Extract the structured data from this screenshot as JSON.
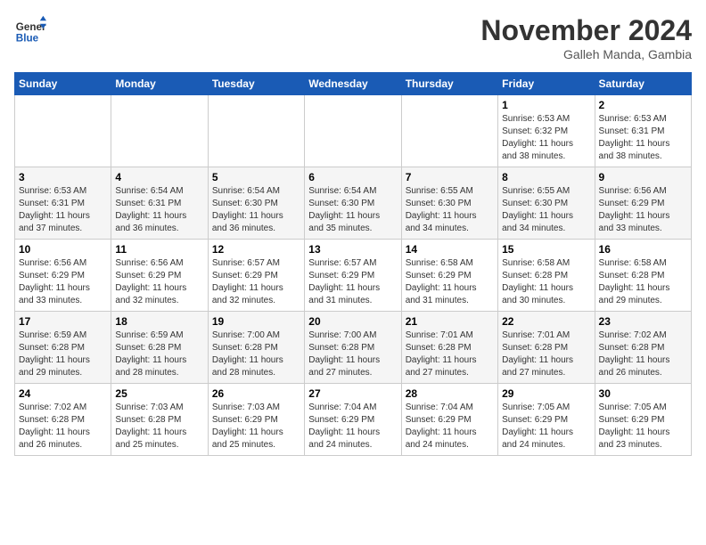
{
  "header": {
    "logo_line1": "General",
    "logo_line2": "Blue",
    "month_title": "November 2024",
    "subtitle": "Galleh Manda, Gambia"
  },
  "days_of_week": [
    "Sunday",
    "Monday",
    "Tuesday",
    "Wednesday",
    "Thursday",
    "Friday",
    "Saturday"
  ],
  "weeks": [
    [
      {
        "day": "",
        "detail": ""
      },
      {
        "day": "",
        "detail": ""
      },
      {
        "day": "",
        "detail": ""
      },
      {
        "day": "",
        "detail": ""
      },
      {
        "day": "",
        "detail": ""
      },
      {
        "day": "1",
        "detail": "Sunrise: 6:53 AM\nSunset: 6:32 PM\nDaylight: 11 hours\nand 38 minutes."
      },
      {
        "day": "2",
        "detail": "Sunrise: 6:53 AM\nSunset: 6:31 PM\nDaylight: 11 hours\nand 38 minutes."
      }
    ],
    [
      {
        "day": "3",
        "detail": "Sunrise: 6:53 AM\nSunset: 6:31 PM\nDaylight: 11 hours\nand 37 minutes."
      },
      {
        "day": "4",
        "detail": "Sunrise: 6:54 AM\nSunset: 6:31 PM\nDaylight: 11 hours\nand 36 minutes."
      },
      {
        "day": "5",
        "detail": "Sunrise: 6:54 AM\nSunset: 6:30 PM\nDaylight: 11 hours\nand 36 minutes."
      },
      {
        "day": "6",
        "detail": "Sunrise: 6:54 AM\nSunset: 6:30 PM\nDaylight: 11 hours\nand 35 minutes."
      },
      {
        "day": "7",
        "detail": "Sunrise: 6:55 AM\nSunset: 6:30 PM\nDaylight: 11 hours\nand 34 minutes."
      },
      {
        "day": "8",
        "detail": "Sunrise: 6:55 AM\nSunset: 6:30 PM\nDaylight: 11 hours\nand 34 minutes."
      },
      {
        "day": "9",
        "detail": "Sunrise: 6:56 AM\nSunset: 6:29 PM\nDaylight: 11 hours\nand 33 minutes."
      }
    ],
    [
      {
        "day": "10",
        "detail": "Sunrise: 6:56 AM\nSunset: 6:29 PM\nDaylight: 11 hours\nand 33 minutes."
      },
      {
        "day": "11",
        "detail": "Sunrise: 6:56 AM\nSunset: 6:29 PM\nDaylight: 11 hours\nand 32 minutes."
      },
      {
        "day": "12",
        "detail": "Sunrise: 6:57 AM\nSunset: 6:29 PM\nDaylight: 11 hours\nand 32 minutes."
      },
      {
        "day": "13",
        "detail": "Sunrise: 6:57 AM\nSunset: 6:29 PM\nDaylight: 11 hours\nand 31 minutes."
      },
      {
        "day": "14",
        "detail": "Sunrise: 6:58 AM\nSunset: 6:29 PM\nDaylight: 11 hours\nand 31 minutes."
      },
      {
        "day": "15",
        "detail": "Sunrise: 6:58 AM\nSunset: 6:28 PM\nDaylight: 11 hours\nand 30 minutes."
      },
      {
        "day": "16",
        "detail": "Sunrise: 6:58 AM\nSunset: 6:28 PM\nDaylight: 11 hours\nand 29 minutes."
      }
    ],
    [
      {
        "day": "17",
        "detail": "Sunrise: 6:59 AM\nSunset: 6:28 PM\nDaylight: 11 hours\nand 29 minutes."
      },
      {
        "day": "18",
        "detail": "Sunrise: 6:59 AM\nSunset: 6:28 PM\nDaylight: 11 hours\nand 28 minutes."
      },
      {
        "day": "19",
        "detail": "Sunrise: 7:00 AM\nSunset: 6:28 PM\nDaylight: 11 hours\nand 28 minutes."
      },
      {
        "day": "20",
        "detail": "Sunrise: 7:00 AM\nSunset: 6:28 PM\nDaylight: 11 hours\nand 27 minutes."
      },
      {
        "day": "21",
        "detail": "Sunrise: 7:01 AM\nSunset: 6:28 PM\nDaylight: 11 hours\nand 27 minutes."
      },
      {
        "day": "22",
        "detail": "Sunrise: 7:01 AM\nSunset: 6:28 PM\nDaylight: 11 hours\nand 27 minutes."
      },
      {
        "day": "23",
        "detail": "Sunrise: 7:02 AM\nSunset: 6:28 PM\nDaylight: 11 hours\nand 26 minutes."
      }
    ],
    [
      {
        "day": "24",
        "detail": "Sunrise: 7:02 AM\nSunset: 6:28 PM\nDaylight: 11 hours\nand 26 minutes."
      },
      {
        "day": "25",
        "detail": "Sunrise: 7:03 AM\nSunset: 6:28 PM\nDaylight: 11 hours\nand 25 minutes."
      },
      {
        "day": "26",
        "detail": "Sunrise: 7:03 AM\nSunset: 6:29 PM\nDaylight: 11 hours\nand 25 minutes."
      },
      {
        "day": "27",
        "detail": "Sunrise: 7:04 AM\nSunset: 6:29 PM\nDaylight: 11 hours\nand 24 minutes."
      },
      {
        "day": "28",
        "detail": "Sunrise: 7:04 AM\nSunset: 6:29 PM\nDaylight: 11 hours\nand 24 minutes."
      },
      {
        "day": "29",
        "detail": "Sunrise: 7:05 AM\nSunset: 6:29 PM\nDaylight: 11 hours\nand 24 minutes."
      },
      {
        "day": "30",
        "detail": "Sunrise: 7:05 AM\nSunset: 6:29 PM\nDaylight: 11 hours\nand 23 minutes."
      }
    ]
  ]
}
